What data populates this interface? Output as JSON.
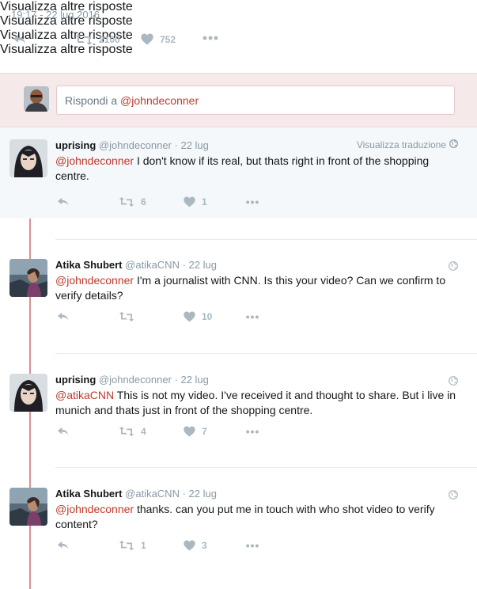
{
  "timestamp": "19:17 - 22 lug 2016",
  "main_actions": {
    "retweet_count": "2100",
    "like_count": "752"
  },
  "reply_box": {
    "prefix": "Rispondi a ",
    "mention": "@johndeconner"
  },
  "tweets": [
    {
      "name": "uprising",
      "handle": "@johndeconner",
      "date": "22 lug",
      "translate": "Visualizza traduzione",
      "mention": "@johndeconner",
      "text": " I don't know if its real, but thats right in front of the shopping centre.",
      "retweets": "6",
      "likes": "1",
      "more_replies": "Visualizza altre risposte"
    },
    {
      "name": "Atika Shubert",
      "handle": "@atikaCNN",
      "date": "22 lug",
      "mention": "@johndeconner",
      "text": " I'm a journalist with CNN. Is this your video? Can we confirm to verify details?",
      "retweets": "",
      "likes": "10",
      "more_replies": "Visualizza altre risposte"
    },
    {
      "name": "uprising",
      "handle": "@johndeconner",
      "date": "22 lug",
      "mention": "@atikaCNN",
      "text": " This is not my video. I've received it and thought to share. But i live in munich and thats just in front of the shopping centre.",
      "retweets": "4",
      "likes": "7",
      "more_replies": "Visualizza altre risposte"
    },
    {
      "name": "Atika Shubert",
      "handle": "@atikaCNN",
      "date": "22 lug",
      "mention": "@johndeconner",
      "text": " thanks. can you put me in touch with who shot video to verify content?",
      "retweets": "1",
      "likes": "3",
      "more_replies": "Visualizza altre risposte"
    }
  ]
}
